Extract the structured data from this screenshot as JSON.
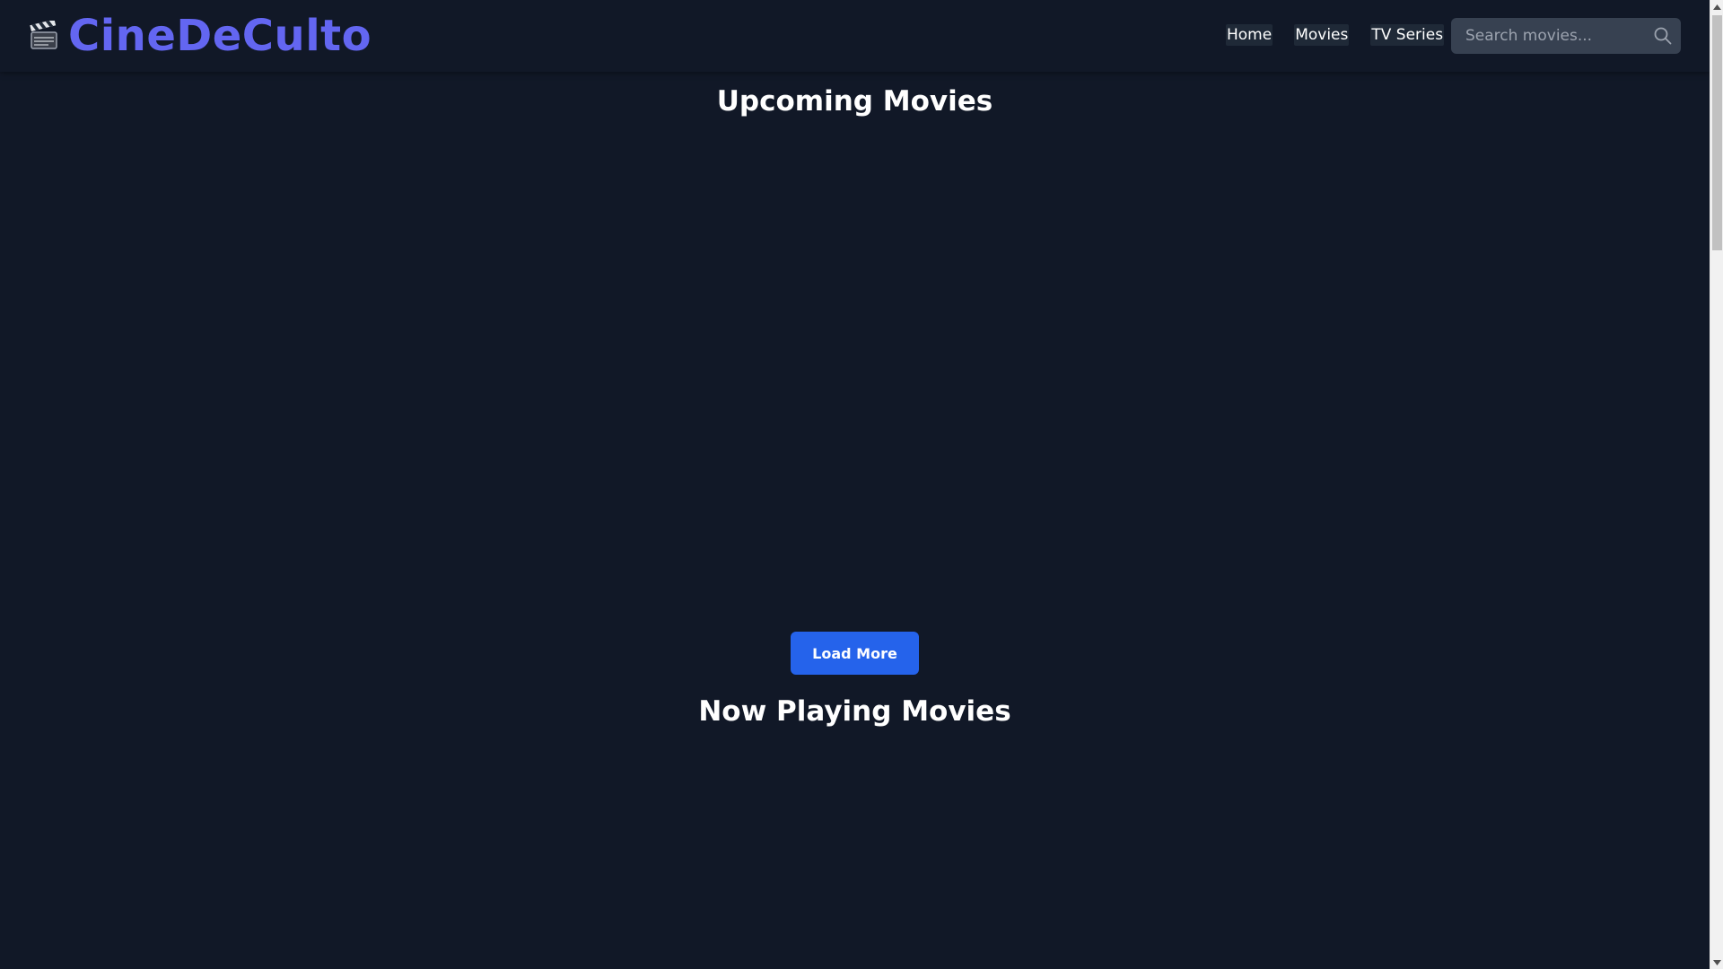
{
  "header": {
    "logo_icon": "clapperboard-icon",
    "logo_text": "CineDeCulto",
    "brand_color": "#6366f1",
    "nav": [
      {
        "label": "Home"
      },
      {
        "label": "Movies"
      },
      {
        "label": "TV Series"
      }
    ],
    "search": {
      "placeholder": "Search movies...",
      "value": "",
      "icon": "search-icon"
    }
  },
  "sections": {
    "upcoming": {
      "title": "Upcoming Movies",
      "load_more_label": "Load More"
    },
    "now_playing": {
      "title": "Now Playing Movies"
    }
  },
  "colors": {
    "background": "#111827",
    "accent": "#2563eb",
    "search_bg": "#374151"
  }
}
